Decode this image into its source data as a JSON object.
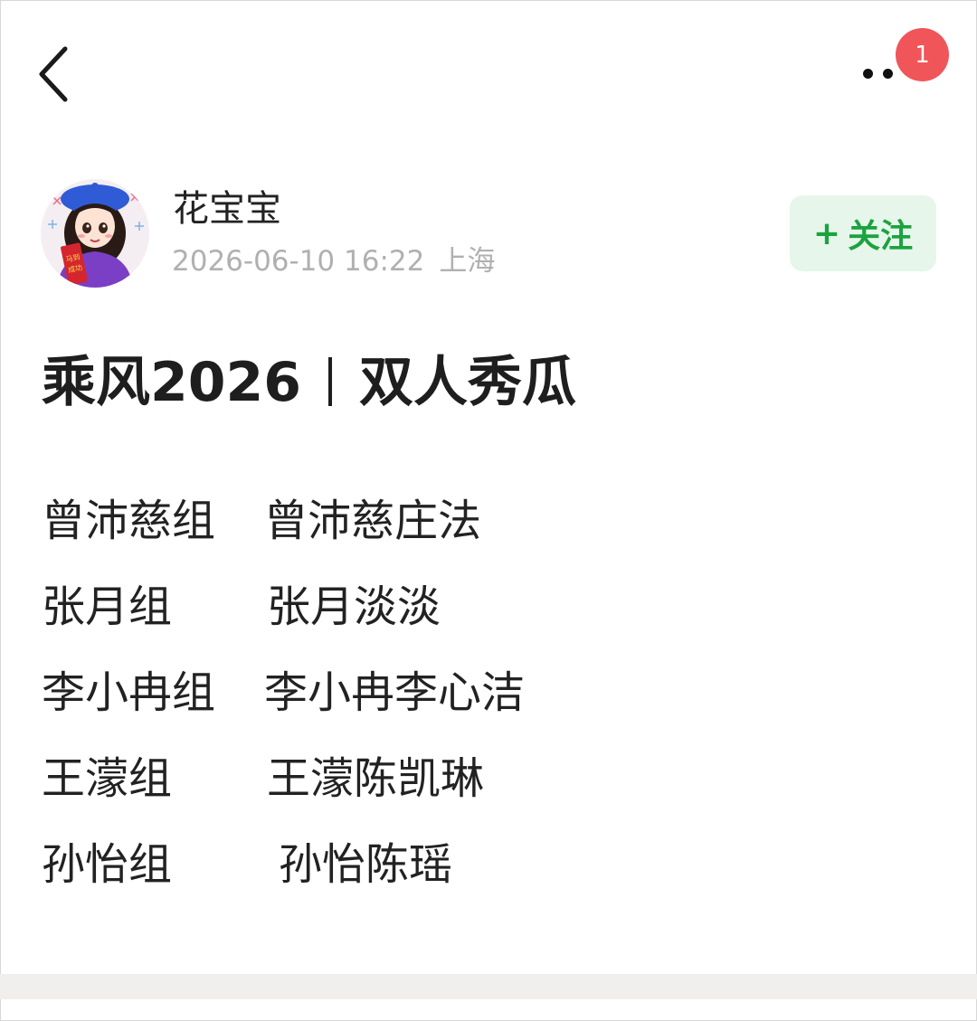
{
  "header": {
    "notification_count": "1"
  },
  "author": {
    "name": "花宝宝",
    "date": "2026-06-10 16:22",
    "location": "上海",
    "avatar_text": "马到成功",
    "follow_plus": "+",
    "follow_label": "关注"
  },
  "post": {
    "title_left": "乘风2026",
    "title_right": "双人秀瓜",
    "rows": [
      {
        "group": "曾沛慈组",
        "members": "曾沛慈庄法"
      },
      {
        "group": "张月组",
        "members": "张月淡淡"
      },
      {
        "group": "李小冉组",
        "members": "李小冉李心洁"
      },
      {
        "group": "王濛组",
        "members": "王濛陈凯琳"
      },
      {
        "group": "孙怡组",
        "members": "孙怡陈瑶"
      }
    ]
  },
  "colors": {
    "follow_text": "#1aa33f",
    "follow_bg": "#e6f6ea",
    "badge_bg": "#f0555a",
    "meta_text": "#b0b0b0"
  }
}
